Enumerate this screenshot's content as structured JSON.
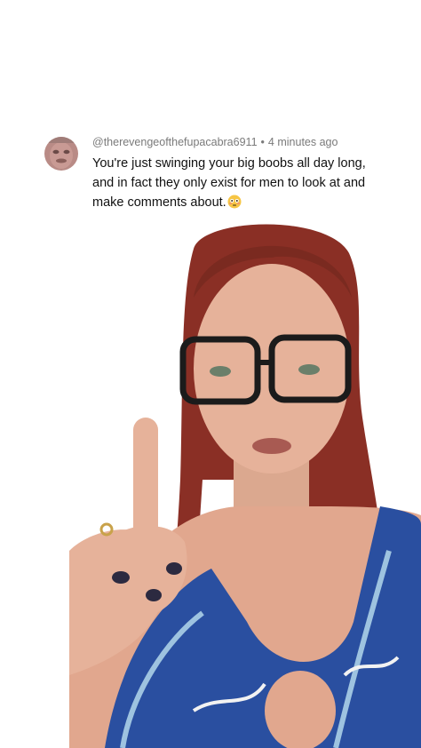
{
  "comment": {
    "username": "@therevengeofthefupacabra6911",
    "separator": "•",
    "time": "4 minutes ago",
    "text_line1": "You're just swinging your big boobs all day long,",
    "text_line2": "and in fact they only exist for men to look at and",
    "text_line3": "make comments about.",
    "emoji_icon": "flushed-face-emoji"
  },
  "video": {
    "subject": "person-in-blue-paisley-top-pointing-up"
  },
  "colors": {
    "background": "#ffffff",
    "meta_text": "#7a7a7a",
    "body_text": "#111111",
    "hair": "#8a2f25",
    "skin": "#e6b29a",
    "top_blue": "#2a4fa0"
  }
}
